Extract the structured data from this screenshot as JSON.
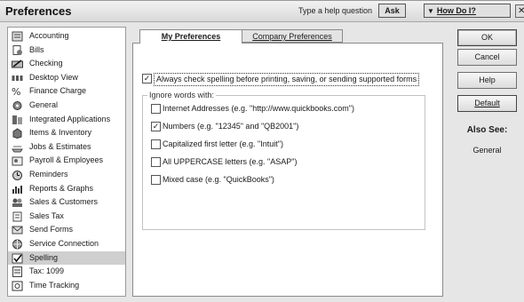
{
  "titlebar": {
    "title": "Preferences",
    "help_prompt": "Type a help question",
    "ask_label": "Ask",
    "howdoi_label": "How Do I?"
  },
  "categories": [
    {
      "label": "Accounting",
      "icon": "accounting-icon"
    },
    {
      "label": "Bills",
      "icon": "bills-icon"
    },
    {
      "label": "Checking",
      "icon": "checking-icon"
    },
    {
      "label": "Desktop View",
      "icon": "desktop-view-icon"
    },
    {
      "label": "Finance Charge",
      "icon": "finance-charge-icon"
    },
    {
      "label": "General",
      "icon": "general-icon"
    },
    {
      "label": "Integrated Applications",
      "icon": "integrated-apps-icon"
    },
    {
      "label": "Items & Inventory",
      "icon": "items-inventory-icon"
    },
    {
      "label": "Jobs & Estimates",
      "icon": "jobs-estimates-icon"
    },
    {
      "label": "Payroll & Employees",
      "icon": "payroll-icon"
    },
    {
      "label": "Reminders",
      "icon": "reminders-icon"
    },
    {
      "label": "Reports & Graphs",
      "icon": "reports-graphs-icon"
    },
    {
      "label": "Sales & Customers",
      "icon": "sales-customers-icon"
    },
    {
      "label": "Sales Tax",
      "icon": "sales-tax-icon"
    },
    {
      "label": "Send Forms",
      "icon": "send-forms-icon"
    },
    {
      "label": "Service Connection",
      "icon": "service-connection-icon"
    },
    {
      "label": "Spelling",
      "icon": "spelling-icon",
      "selected": true
    },
    {
      "label": "Tax: 1099",
      "icon": "tax-1099-icon"
    },
    {
      "label": "Time Tracking",
      "icon": "time-tracking-icon"
    }
  ],
  "tabs": {
    "my_prefs": "My Preferences",
    "company_prefs": "Company Preferences"
  },
  "spelling": {
    "always_check_label": "Always check spelling before printing, saving, or sending supported forms",
    "always_check_checked": true,
    "ignore_group_label": "Ignore words with:",
    "options": [
      {
        "label": "Internet Addresses (e.g. \"http://www.quickbooks.com\")",
        "checked": false
      },
      {
        "label": "Numbers (e.g. \"12345\" and \"QB2001\")",
        "checked": true
      },
      {
        "label": "Capitalized first letter (e.g. \"Intuit\")",
        "checked": false
      },
      {
        "label": "All UPPERCASE letters (e.g. \"ASAP\")",
        "checked": false
      },
      {
        "label": "Mixed case (e.g. \"QuickBooks\")",
        "checked": false
      }
    ]
  },
  "buttons": {
    "ok": "OK",
    "cancel": "Cancel",
    "help": "Help",
    "default": "Default"
  },
  "also_see": {
    "heading": "Also See:",
    "link": "General"
  }
}
